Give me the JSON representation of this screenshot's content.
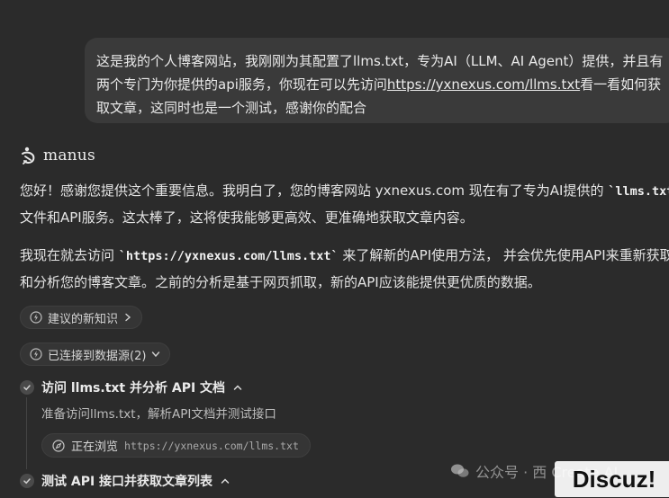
{
  "user_message": {
    "text_before_link": "这是我的个人博客网站，我刚刚为其配置了llms.txt，专为AI（LLM、AI Agent）提供，并且有两个专门为你提供的api服务，你现在可以先访问",
    "link": "https://yxnexus.com/llms.txt",
    "text_after_link": "看一看如何获取文章，这同时也是一个测试，感谢你的配合"
  },
  "assistant": {
    "name": "manus",
    "p1_a": "您好！感谢您提供这个重要信息。我明白了，您的博客网站 yxnexus.com 现在有了专为AI提供的 ",
    "p1_code": "`llms.txt`",
    "p1_b": " 文件和API服务。这太棒了，这将使我能够更高效、更准确地获取文章内容。",
    "p2_a": "我现在就去访问 ",
    "p2_code": "`https://yxnexus.com/llms.txt`",
    "p2_b": " 来了解新的API使用方法， 并会优先使用API来重新获取和分析您的博客文章。之前的分析是基于网页抓取，新的API应该能提供更优质的数据。"
  },
  "chips": {
    "suggested_knowledge": "建议的新知识",
    "connected_sources": "已连接到数据源(2)"
  },
  "tasks": [
    {
      "title": "访问 llms.txt 并分析 API 文档",
      "detail": "准备访问llms.txt，解析API文档并测试接口",
      "browse_label": "正在浏览",
      "browse_url": "https://yxnexus.com/llms.txt"
    },
    {
      "title": "测试 API 接口并获取文章列表"
    }
  ],
  "watermark": {
    "text": "公众号 · 西 Create AI",
    "discuz": "Discuz!"
  }
}
